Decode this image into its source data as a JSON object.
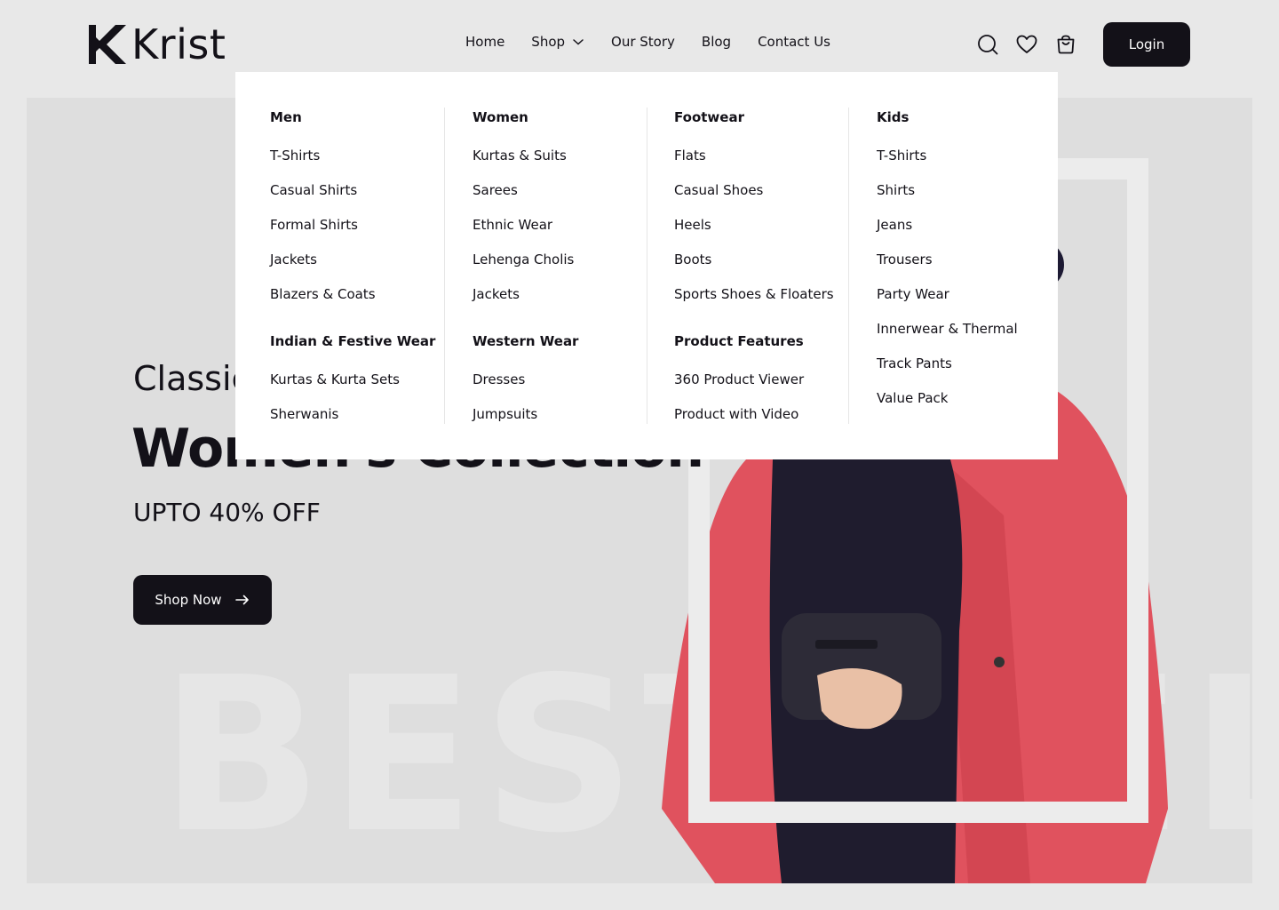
{
  "brand": {
    "name": "Krist"
  },
  "nav": {
    "items": [
      {
        "label": "Home"
      },
      {
        "label": "Shop"
      },
      {
        "label": "Our Story"
      },
      {
        "label": "Blog"
      },
      {
        "label": "Contact Us"
      }
    ]
  },
  "header": {
    "login_label": "Login"
  },
  "hero": {
    "eyebrow": "Classic Exclusive",
    "title": "Women's Collection",
    "offer": "UPTO 40% OFF",
    "cta_label": "Shop Now",
    "background_word": "BEST SELLER"
  },
  "mega_menu": {
    "columns": [
      {
        "groups": [
          {
            "heading": "Men",
            "items": [
              "T-Shirts",
              "Casual Shirts",
              "Formal Shirts",
              "Jackets",
              "Blazers & Coats"
            ]
          },
          {
            "heading": "Indian & Festive Wear",
            "items": [
              "Kurtas & Kurta Sets",
              "Sherwanis"
            ]
          }
        ]
      },
      {
        "groups": [
          {
            "heading": "Women",
            "items": [
              "Kurtas & Suits",
              "Sarees",
              "Ethnic Wear",
              "Lehenga Cholis",
              "Jackets"
            ]
          },
          {
            "heading": "Western Wear",
            "items": [
              "Dresses",
              "Jumpsuits"
            ]
          }
        ]
      },
      {
        "groups": [
          {
            "heading": "Footwear",
            "items": [
              "Flats",
              "Casual Shoes",
              "Heels",
              "Boots",
              "Sports Shoes & Floaters"
            ]
          },
          {
            "heading": "Product Features",
            "items": [
              "360 Product Viewer",
              "Product with Video"
            ]
          }
        ]
      },
      {
        "groups": [
          {
            "heading": "Kids",
            "items": [
              "T-Shirts",
              "Shirts",
              "Jeans",
              "Trousers",
              "Party Wear",
              "Innerwear & Thermal",
              "Track Pants",
              "Value Pack"
            ]
          }
        ]
      }
    ]
  },
  "colors": {
    "primary": "#131118",
    "hero_bg": "#dedede",
    "coat": "#e0525e"
  }
}
